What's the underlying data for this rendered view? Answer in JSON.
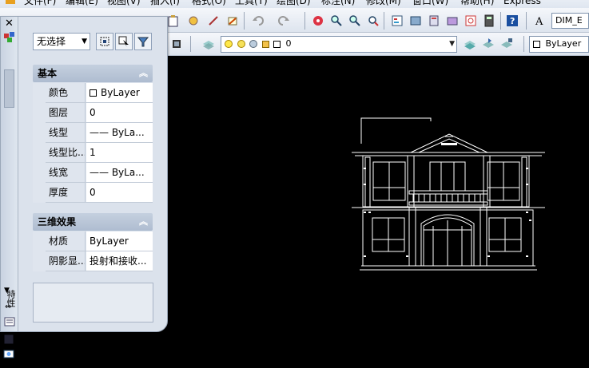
{
  "menu": [
    "文件(F)",
    "编辑(E)",
    "视图(V)",
    "插入(I)",
    "格式(O)",
    "工具(T)",
    "绘图(D)",
    "标注(N)",
    "修改(M)",
    "窗口(W)",
    "帮助(H)",
    "Express"
  ],
  "toolbar": {
    "dimstyle_value": "DIM_E",
    "layer_value": "0",
    "color_value": "ByLayer"
  },
  "palette": {
    "select_value": "无选择",
    "side_label": "特性",
    "sections": [
      {
        "title": "基本",
        "rows": [
          {
            "name": "颜色",
            "value": "ByLayer"
          },
          {
            "name": "图层",
            "value": "0"
          },
          {
            "name": "线型",
            "value": "—— ByLa..."
          },
          {
            "name": "线型比...",
            "value": "1"
          },
          {
            "name": "线宽",
            "value": "—— ByLa..."
          },
          {
            "name": "厚度",
            "value": "0"
          }
        ]
      },
      {
        "title": "三维效果",
        "rows": [
          {
            "name": "材质",
            "value": "ByLayer"
          },
          {
            "name": "阴影显...",
            "value": "投射和接收..."
          }
        ]
      }
    ]
  },
  "icons": [
    "close-icon",
    "properties-icon",
    "quick-select-icon",
    "select-objects-icon",
    "filter-icon",
    "collapse-icon",
    "scroll-down-icon"
  ]
}
